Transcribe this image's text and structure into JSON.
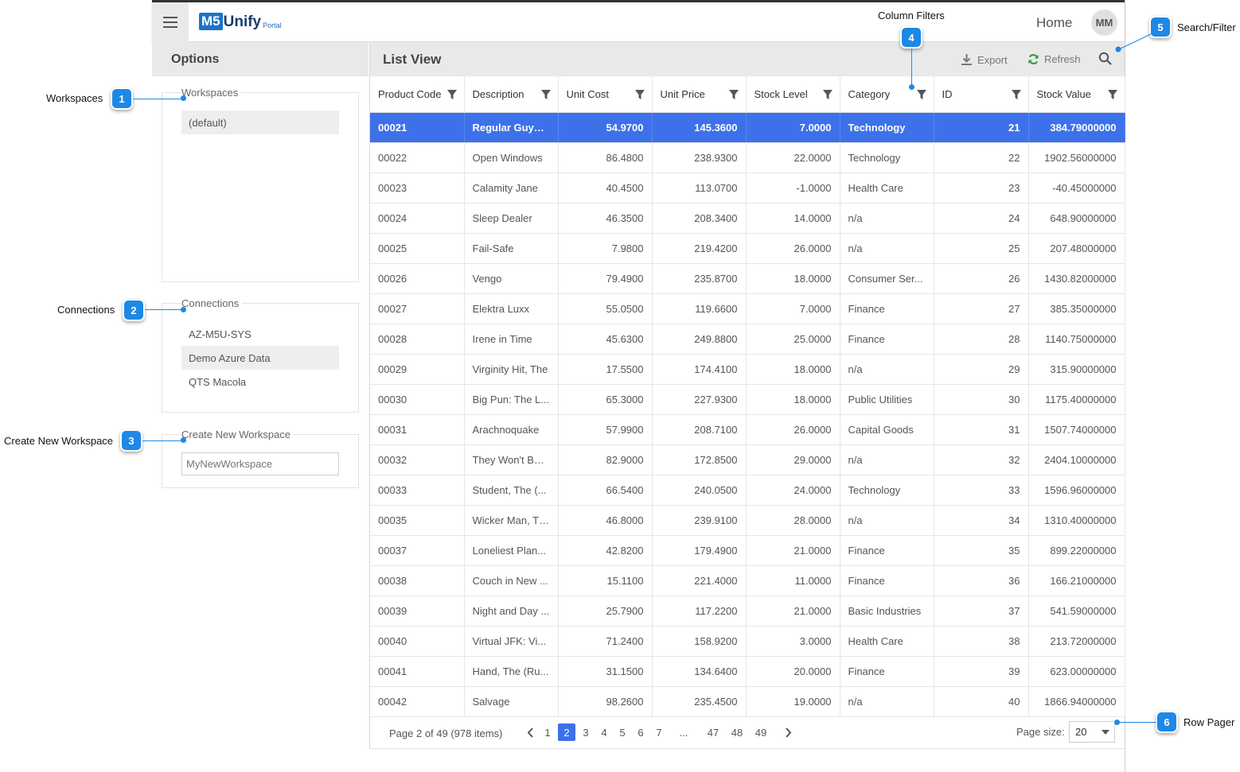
{
  "header": {
    "logo_m5": "M5",
    "logo_unify": "Unify",
    "logo_portal": "Portal",
    "home": "Home",
    "avatar": "MM"
  },
  "options": {
    "title": "Options",
    "workspaces_legend": "Workspaces",
    "workspaces": [
      "(default)"
    ],
    "connections_legend": "Connections",
    "connections": [
      "AZ-M5U-SYS",
      "Demo Azure Data",
      "QTS Macola"
    ],
    "create_legend": "Create New Workspace",
    "create_placeholder": "MyNewWorkspace"
  },
  "listview": {
    "title": "List View",
    "export": "Export",
    "refresh": "Refresh"
  },
  "grid": {
    "columns": [
      "Product Code",
      "Description",
      "Unit Cost",
      "Unit Price",
      "Stock Level",
      "Category",
      "ID",
      "Stock Value"
    ],
    "rows": [
      [
        "00021",
        "Regular Guys (...",
        "54.9700",
        "145.3600",
        "7.0000",
        "Technology",
        "21",
        "384.79000000"
      ],
      [
        "00022",
        "Open Windows",
        "86.4800",
        "238.9300",
        "22.0000",
        "Technology",
        "22",
        "1902.56000000"
      ],
      [
        "00023",
        "Calamity Jane",
        "40.4500",
        "113.0700",
        "-1.0000",
        "Health Care",
        "23",
        "-40.45000000"
      ],
      [
        "00024",
        "Sleep Dealer",
        "46.3500",
        "208.3400",
        "14.0000",
        "n/a",
        "24",
        "648.90000000"
      ],
      [
        "00025",
        "Fail-Safe",
        "7.9800",
        "219.4200",
        "26.0000",
        "n/a",
        "25",
        "207.48000000"
      ],
      [
        "00026",
        "Vengo",
        "79.4900",
        "235.8700",
        "18.0000",
        "Consumer Ser...",
        "26",
        "1430.82000000"
      ],
      [
        "00027",
        "Elektra Luxx",
        "55.0500",
        "119.6600",
        "7.0000",
        "Finance",
        "27",
        "385.35000000"
      ],
      [
        "00028",
        "Irene in Time",
        "45.6300",
        "249.8800",
        "25.0000",
        "Finance",
        "28",
        "1140.75000000"
      ],
      [
        "00029",
        "Virginity Hit, The",
        "17.5500",
        "174.4100",
        "18.0000",
        "n/a",
        "29",
        "315.90000000"
      ],
      [
        "00030",
        "Big Pun: The L...",
        "65.3000",
        "227.9300",
        "18.0000",
        "Public Utilities",
        "30",
        "1175.40000000"
      ],
      [
        "00031",
        "Arachnoquake",
        "57.9900",
        "208.7100",
        "26.0000",
        "Capital Goods",
        "31",
        "1507.74000000"
      ],
      [
        "00032",
        "They Won't Bel...",
        "82.9000",
        "172.8500",
        "29.0000",
        "n/a",
        "32",
        "2404.10000000"
      ],
      [
        "00033",
        "Student, The (...",
        "66.5400",
        "240.0500",
        "24.0000",
        "Technology",
        "33",
        "1596.96000000"
      ],
      [
        "00035",
        "Wicker Man, The",
        "46.8000",
        "239.9100",
        "28.0000",
        "n/a",
        "34",
        "1310.40000000"
      ],
      [
        "00037",
        "Loneliest Plan...",
        "42.8200",
        "179.4900",
        "21.0000",
        "Finance",
        "35",
        "899.22000000"
      ],
      [
        "00038",
        "Couch in New ...",
        "15.1100",
        "221.4000",
        "11.0000",
        "Finance",
        "36",
        "166.21000000"
      ],
      [
        "00039",
        "Night and Day ...",
        "25.7900",
        "117.2200",
        "21.0000",
        "Basic Industries",
        "37",
        "541.59000000"
      ],
      [
        "00040",
        "Virtual JFK: Vi...",
        "71.2400",
        "158.9200",
        "3.0000",
        "Health Care",
        "38",
        "213.72000000"
      ],
      [
        "00041",
        "Hand, The (Ru...",
        "31.1500",
        "134.6400",
        "20.0000",
        "Finance",
        "39",
        "623.00000000"
      ],
      [
        "00042",
        "Salvage",
        "98.2600",
        "235.4500",
        "19.0000",
        "n/a",
        "40",
        "1866.94000000"
      ]
    ]
  },
  "pager": {
    "info": "Page 2 of 49 (978 items)",
    "pages": [
      "1",
      "2",
      "3",
      "4",
      "5",
      "6",
      "7",
      "...",
      "47",
      "48",
      "49"
    ],
    "current": "2",
    "page_size_label": "Page size:",
    "page_size": "20"
  },
  "callouts": [
    {
      "num": "1",
      "label": "Workspaces"
    },
    {
      "num": "2",
      "label": "Connections"
    },
    {
      "num": "3",
      "label": "Create New Workspace"
    },
    {
      "num": "4",
      "label": "Column Filters"
    },
    {
      "num": "5",
      "label": "Search/Filter"
    },
    {
      "num": "6",
      "label": "Row Pager"
    }
  ],
  "colors": {
    "accent": "#3d71ea",
    "callout": "#1e88e5",
    "brand": "#1a73c9",
    "refresh_icon": "#2e9e3f"
  }
}
